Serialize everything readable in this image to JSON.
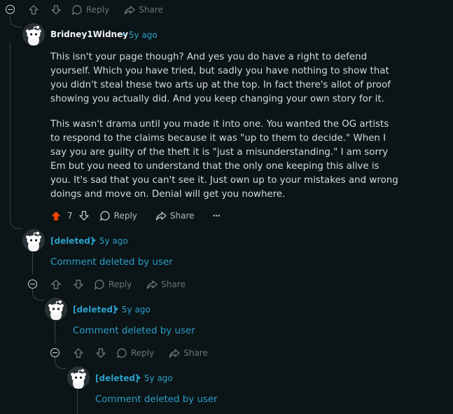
{
  "top_actions": {
    "reply_label": "Reply",
    "share_label": "Share"
  },
  "main_comment": {
    "username": "Bridney1Widney",
    "time": "5y ago",
    "paragraph1": "This isn't your page though? And yes you do have a right to defend yourself. Which you have tried, but sadly you have nothing to show that you didn't steal these two arts up at the top. In fact there's allot of proof showing you actually did. And you keep changing your own story for it.",
    "paragraph2": "This wasn't drama until you made it into one. You wanted the OG artists to respond to the claims because it was \"up to them to decide.\" When I say you are guilty of the theft it is \"just a misunderstanding.\" I am sorry Em but you need to understand that the only one keeping this alive is you. It's sad that you can't see it. Just own up to your mistakes and wrong doings and move on. Denial will get you nowhere.",
    "vote_count": "7",
    "reply_label": "Reply",
    "share_label": "Share",
    "more_label": "···"
  },
  "deleted_comments": [
    {
      "username": "[deleted]",
      "time": "5y ago",
      "text": "Comment deleted by user",
      "reply_label": "Reply",
      "share_label": "Share"
    },
    {
      "username": "[deleted]",
      "time": "5y ago",
      "text": "Comment deleted by user",
      "reply_label": "Reply",
      "share_label": "Share"
    },
    {
      "username": "[deleted]",
      "time": "5y ago",
      "text": "Comment deleted by user"
    }
  ],
  "colors": {
    "background": "#0b1416",
    "upvote_active": "#ff4500",
    "link": "#2b9fc9"
  }
}
